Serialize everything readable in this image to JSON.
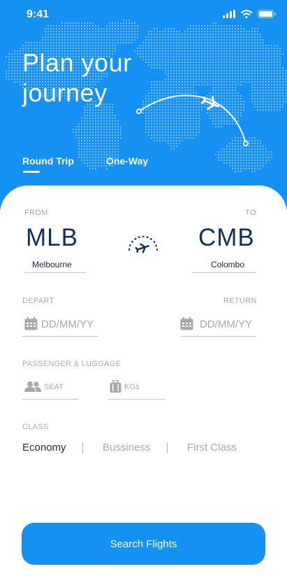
{
  "status": {
    "time": "9:41"
  },
  "hero": {
    "title": "Plan your journey"
  },
  "tabs": [
    {
      "label": "Round Trip",
      "active": true
    },
    {
      "label": "One-Way",
      "active": false
    }
  ],
  "route": {
    "from_label": "FROM",
    "to_label": "TO",
    "from_code": "MLB",
    "from_city": "Melbourne",
    "to_code": "CMB",
    "to_city": "Colombo"
  },
  "dates": {
    "depart_label": "DEPART",
    "return_label": "RETURN",
    "depart_placeholder": "DD/MM/YY",
    "return_placeholder": "DD/MM/YY"
  },
  "passenger": {
    "label": "PASSENGER & LUGGAGE",
    "seat_placeholder": "SEAT",
    "kg_placeholder": "KGs"
  },
  "travel_class": {
    "label": "CLASS",
    "options": [
      "Economy",
      "Bussiness",
      "First Class"
    ],
    "selected": "Economy"
  },
  "search_button": "Search Flights",
  "colors": {
    "primary": "#1590f3",
    "code": "#12305d",
    "muted": "#a9a9ad"
  },
  "icons": [
    "signal-icon",
    "wifi-icon",
    "battery-icon",
    "airplane-icon",
    "calendar-icon",
    "people-icon",
    "luggage-icon"
  ]
}
